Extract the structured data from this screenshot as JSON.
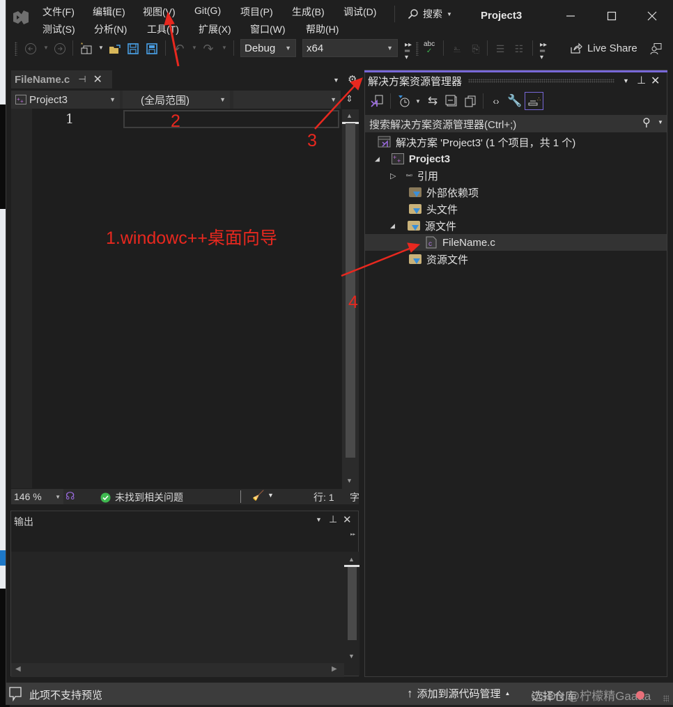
{
  "title_bar": {
    "window_title": "Project3",
    "search_label": "搜索",
    "menu_row1": [
      "文件(F)",
      "编辑(E)",
      "视图(V)",
      "Git(G)",
      "项目(P)",
      "生成(B)",
      "调试(D)"
    ],
    "menu_row2": [
      "测试(S)",
      "分析(N)",
      "工具(T)",
      "扩展(X)",
      "窗口(W)",
      "帮助(H)"
    ]
  },
  "toolbar": {
    "configuration": "Debug",
    "platform": "x64",
    "live_share_label": "Live Share"
  },
  "editor": {
    "tab_label": "FileName.c",
    "project_dropdown": "Project3",
    "scope_dropdown": "(全局范围)",
    "member_dropdown": "",
    "line_number": "1",
    "zoom_level": "146 %",
    "issues_text": "未找到相关问题",
    "line_indicator": "行: 1",
    "col_indicator_partial": "字"
  },
  "output_panel": {
    "title": "输出"
  },
  "solution_explorer": {
    "title": "解决方案资源管理器",
    "search_placeholder": "搜索解决方案资源管理器(Ctrl+;)",
    "tree": [
      {
        "label": "解决方案 'Project3' (1 个项目，共 1 个)",
        "icon": "solution-icon",
        "level": 0,
        "expander": "none"
      },
      {
        "label": "Project3",
        "icon": "cpp-project-icon",
        "level": 1,
        "expander": "expanded",
        "bold": true
      },
      {
        "label": "引用",
        "icon": "references-icon",
        "level": 2,
        "expander": "collapsed"
      },
      {
        "label": "外部依赖项",
        "icon": "external-deps-icon",
        "level": 2,
        "expander": "none"
      },
      {
        "label": "头文件",
        "icon": "filter-folder-icon",
        "level": 2,
        "expander": "none"
      },
      {
        "label": "源文件",
        "icon": "filter-folder-icon",
        "level": 2,
        "expander": "expanded"
      },
      {
        "label": "FileName.c",
        "icon": "c-file-icon",
        "level": 3,
        "expander": "none",
        "selected": true
      },
      {
        "label": "资源文件",
        "icon": "filter-folder-icon",
        "level": 2,
        "expander": "none"
      }
    ]
  },
  "status_bar": {
    "preview_text": "此项不支持预览",
    "source_control_text": "添加到源代码管理",
    "repo_text": "选择仓库",
    "watermark": "CSDN @柠檬精Gaaaa"
  },
  "annotations": {
    "note1": "1.windowc++桌面向导",
    "note2": "2",
    "note3": "3",
    "note4": "4",
    "color": "#e8281f"
  },
  "colors": {
    "background": "#1f1f1f",
    "accent": "#7868d8",
    "status_bar": "#3c3c3c",
    "annotation": "#e8281f"
  }
}
